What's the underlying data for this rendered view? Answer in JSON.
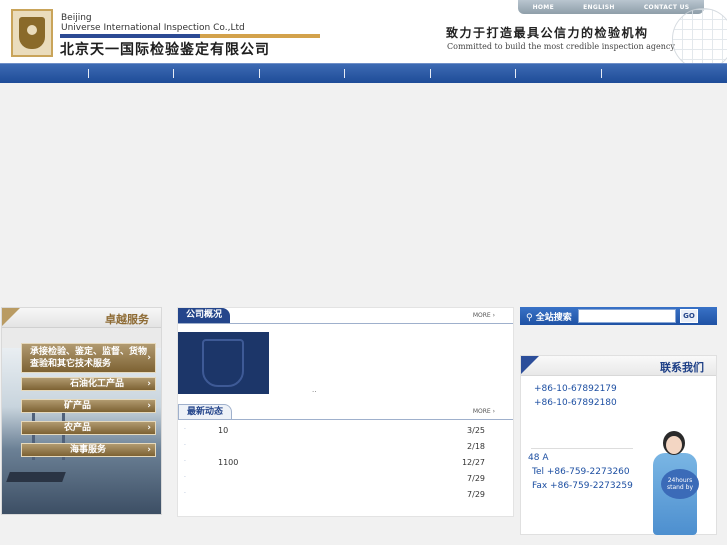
{
  "header": {
    "en_name_line1": "Beijing",
    "en_name_line2": "Universe International Inspection Co.,Ltd",
    "cn_name": "北京天一国际检验鉴定有限公司",
    "slogan_cn": "致力于打造最具公信力的检验机构",
    "slogan_en": "Committed to build the most credible inspection agency",
    "top_links": [
      "HOME",
      "ENGLISH",
      "CONTACT US"
    ]
  },
  "services": {
    "title": "卓越服务",
    "main_item": "承接检验、鉴定、监督、货物查验和其它技术服务",
    "items": [
      "石油化工产品",
      "矿产品",
      "农产品",
      "海事服务"
    ]
  },
  "about": {
    "title": "公司概况",
    "more": "MORE",
    "dots": ".."
  },
  "news": {
    "title": "最新动态",
    "more": "MORE",
    "items": [
      {
        "text": "10",
        "date": "3/25"
      },
      {
        "text": "",
        "date": "2/18"
      },
      {
        "text": "1100",
        "date": "12/27"
      },
      {
        "text": "",
        "date": "7/29"
      },
      {
        "text": "",
        "date": "7/29"
      }
    ]
  },
  "search": {
    "label": "全站搜索",
    "placeholder": "",
    "go_label": "GO"
  },
  "contact": {
    "title": "联系我们",
    "tel1": "+86-10-67892179",
    "tel2": "+86-10-67892180",
    "addr": "48   A",
    "tel3": "Tel +86-759-2273260",
    "fax": "Fax +86-759-2273259",
    "standby_line1": "24hours",
    "standby_line2": "stand by"
  },
  "colors": {
    "nav_blue": "#1e4c98",
    "gold": "#b19a70",
    "link_blue": "#1d4fa2"
  }
}
